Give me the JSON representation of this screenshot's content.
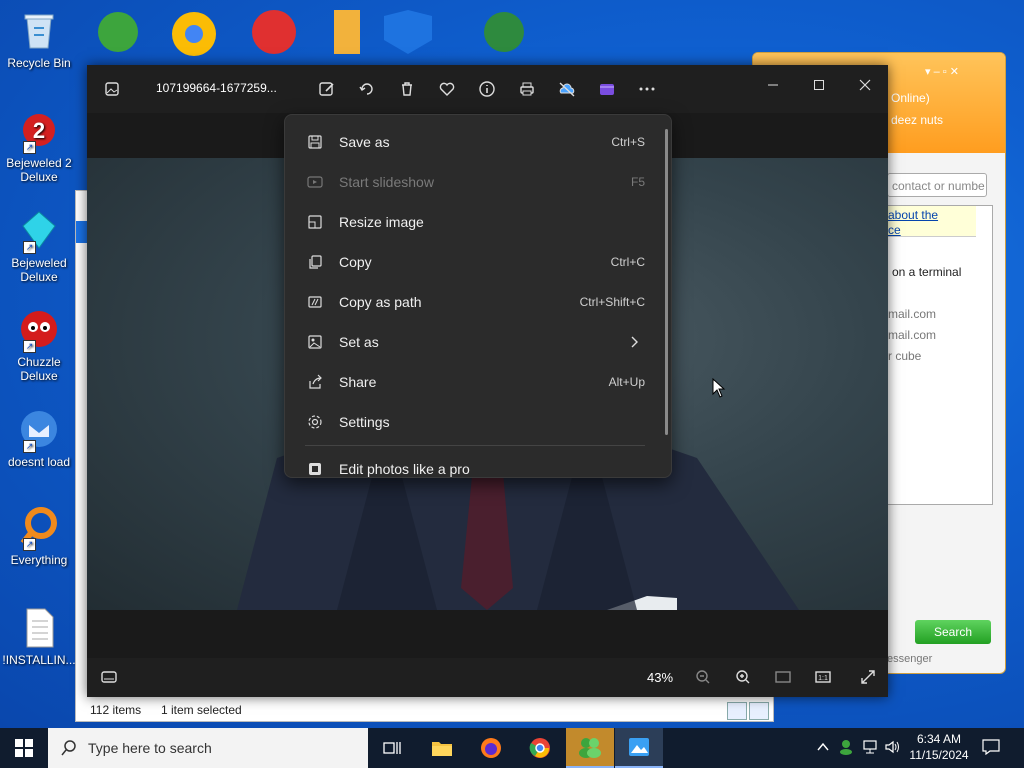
{
  "desktop": {
    "icons": [
      {
        "label": "Recycle Bin",
        "icon": "recycle-bin-icon"
      },
      {
        "label": "Bejeweled 2 Deluxe",
        "icon": "bejeweled2-icon"
      },
      {
        "label": "Bejeweled Deluxe",
        "icon": "bejeweled-icon"
      },
      {
        "label": "Chuzzle Deluxe",
        "icon": "chuzzle-icon"
      },
      {
        "label": "doesnt load",
        "icon": "thunderbird-icon"
      },
      {
        "label": "Everything",
        "icon": "everything-search-icon"
      },
      {
        "label": "!INSTALLIN...",
        "icon": "text-document-icon"
      }
    ]
  },
  "explorer": {
    "status_items": "112 items",
    "status_selected": "1 item selected"
  },
  "messenger": {
    "status": "Online)",
    "name": "deez nuts",
    "search_placeholder": "contact or numbe",
    "link_line1": "about the",
    "link_line2": "ce",
    "text1": "on a terminal",
    "email1": "mail.com",
    "email2": "mail.com",
    "text2": "r cube",
    "search_button": "Search",
    "footer": "essenger"
  },
  "photos": {
    "filename": "107199664-1677259...",
    "zoom": "43%",
    "menu": [
      {
        "label": "Save as",
        "shortcut": "Ctrl+S",
        "icon": "save-icon",
        "disabled": false
      },
      {
        "label": "Start slideshow",
        "shortcut": "F5",
        "icon": "slideshow-icon",
        "disabled": true
      },
      {
        "label": "Resize image",
        "shortcut": "",
        "icon": "resize-icon",
        "disabled": false
      },
      {
        "label": "Copy",
        "shortcut": "Ctrl+C",
        "icon": "copy-icon",
        "disabled": false
      },
      {
        "label": "Copy as path",
        "shortcut": "Ctrl+Shift+C",
        "icon": "copy-path-icon",
        "disabled": false
      },
      {
        "label": "Set as",
        "shortcut": "",
        "icon": "set-as-icon",
        "disabled": false,
        "submenu": true
      },
      {
        "label": "Share",
        "shortcut": "Alt+Up",
        "icon": "share-icon",
        "disabled": false
      },
      {
        "label": "Settings",
        "shortcut": "",
        "icon": "settings-icon",
        "disabled": false
      },
      {
        "label": "Edit photos like a pro",
        "shortcut": "",
        "icon": "edit-pro-icon",
        "disabled": false
      }
    ]
  },
  "taskbar": {
    "search_placeholder": "Type here to search",
    "time": "6:34 AM",
    "date": "11/15/2024"
  }
}
